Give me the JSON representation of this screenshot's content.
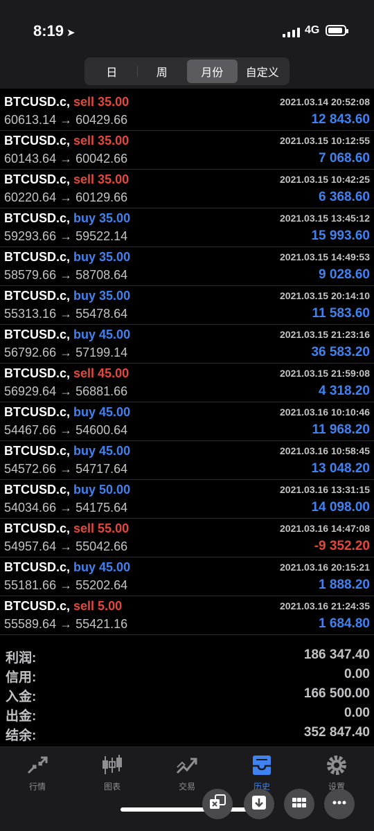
{
  "status_bar": {
    "time": "8:19",
    "network": "4G"
  },
  "period_tabs": [
    {
      "label": "日",
      "active": false
    },
    {
      "label": "周",
      "active": false
    },
    {
      "label": "月份",
      "active": true
    },
    {
      "label": "自定义",
      "active": false
    }
  ],
  "trades": [
    {
      "symbol": "BTCUSD.c,",
      "side": "sell",
      "volume": "sell 35.00",
      "prices": "60613.14 → 60429.66",
      "datetime": "2021.03.14 20:52:08",
      "profit": "12 843.60"
    },
    {
      "symbol": "BTCUSD.c,",
      "side": "sell",
      "volume": "sell 35.00",
      "prices": "60143.64 → 60042.66",
      "datetime": "2021.03.15 10:12:55",
      "profit": "7 068.60"
    },
    {
      "symbol": "BTCUSD.c,",
      "side": "sell",
      "volume": "sell 35.00",
      "prices": "60220.64 → 60129.66",
      "datetime": "2021.03.15 10:42:25",
      "profit": "6 368.60"
    },
    {
      "symbol": "BTCUSD.c,",
      "side": "buy",
      "volume": "buy 35.00",
      "prices": "59293.66 → 59522.14",
      "datetime": "2021.03.15 13:45:12",
      "profit": "15 993.60"
    },
    {
      "symbol": "BTCUSD.c,",
      "side": "buy",
      "volume": "buy 35.00",
      "prices": "58579.66 → 58708.64",
      "datetime": "2021.03.15 14:49:53",
      "profit": "9 028.60"
    },
    {
      "symbol": "BTCUSD.c,",
      "side": "buy",
      "volume": "buy 35.00",
      "prices": "55313.16 → 55478.64",
      "datetime": "2021.03.15 20:14:10",
      "profit": "11 583.60"
    },
    {
      "symbol": "BTCUSD.c,",
      "side": "buy",
      "volume": "buy 45.00",
      "prices": "56792.66 → 57199.14",
      "datetime": "2021.03.15 21:23:16",
      "profit": "36 583.20"
    },
    {
      "symbol": "BTCUSD.c,",
      "side": "sell",
      "volume": "sell 45.00",
      "prices": "56929.64 → 56881.66",
      "datetime": "2021.03.15 21:59:08",
      "profit": "4 318.20"
    },
    {
      "symbol": "BTCUSD.c,",
      "side": "buy",
      "volume": "buy 45.00",
      "prices": "54467.66 → 54600.64",
      "datetime": "2021.03.16 10:10:46",
      "profit": "11 968.20"
    },
    {
      "symbol": "BTCUSD.c,",
      "side": "buy",
      "volume": "buy 45.00",
      "prices": "54572.66 → 54717.64",
      "datetime": "2021.03.16 10:58:45",
      "profit": "13 048.20"
    },
    {
      "symbol": "BTCUSD.c,",
      "side": "buy",
      "volume": "buy 50.00",
      "prices": "54034.66 → 54175.64",
      "datetime": "2021.03.16 13:31:15",
      "profit": "14 098.00"
    },
    {
      "symbol": "BTCUSD.c,",
      "side": "sell",
      "volume": "sell 55.00",
      "prices": "54957.64 → 55042.66",
      "datetime": "2021.03.16 14:47:08",
      "profit": "-9 352.20"
    },
    {
      "symbol": "BTCUSD.c,",
      "side": "buy",
      "volume": "buy 45.00",
      "prices": "55181.66 → 55202.64",
      "datetime": "2021.03.16 20:15:21",
      "profit": "1 888.20"
    },
    {
      "symbol": "BTCUSD.c,",
      "side": "sell",
      "volume": "sell 5.00",
      "prices": "55589.64 → 55421.16",
      "datetime": "2021.03.16 21:24:35",
      "profit": "1 684.80"
    }
  ],
  "summary": [
    {
      "label": "利润:",
      "value": "186 347.40"
    },
    {
      "label": "信用:",
      "value": "0.00"
    },
    {
      "label": "入金:",
      "value": "166 500.00"
    },
    {
      "label": "出金:",
      "value": "0.00"
    },
    {
      "label": "结余:",
      "value": "352 847.40"
    }
  ],
  "tabbar": [
    {
      "label": "行情",
      "icon": "quotes-arrows-icon",
      "active": false
    },
    {
      "label": "图表",
      "icon": "candlestick-chart-icon",
      "active": false
    },
    {
      "label": "交易",
      "icon": "trade-chart-icon",
      "active": false
    },
    {
      "label": "历史",
      "icon": "history-tray-icon",
      "active": true
    },
    {
      "label": "设置",
      "icon": "gear-icon",
      "active": false
    }
  ],
  "floating_actions": [
    {
      "icon": "translate-icon"
    },
    {
      "icon": "download-icon"
    },
    {
      "icon": "grid-icon"
    },
    {
      "icon": "more-icon"
    }
  ],
  "colors": {
    "background": "#000000",
    "sell": "#e8463a",
    "buy": "#3f83f3",
    "muted_text": "#c4c4c6",
    "tabbar_inactive": "#8e8e93"
  }
}
